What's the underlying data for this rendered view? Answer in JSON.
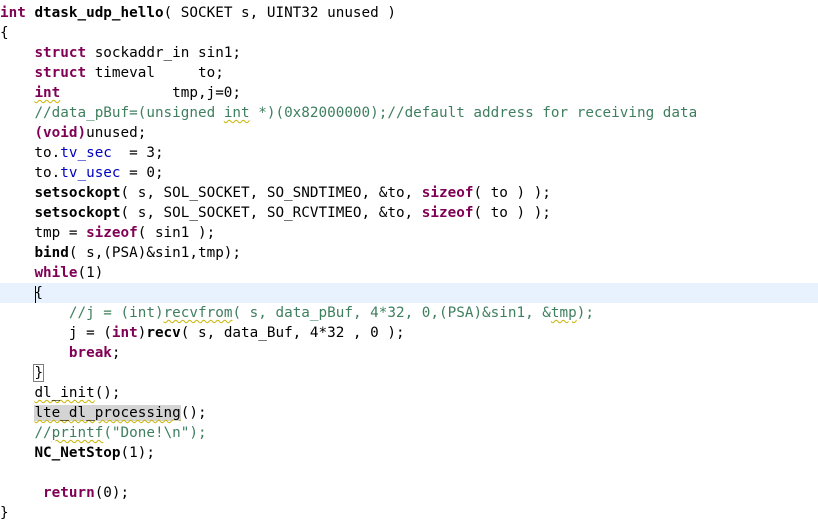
{
  "code": {
    "l1": {
      "t0": "int",
      "t1": " ",
      "t2": "dtask_udp_hello",
      "t3": "( SOCKET s, UINT32 unused )"
    },
    "l2": {
      "t0": "{"
    },
    "l3": {
      "t0": "    ",
      "t1": "struct",
      "t2": " sockaddr_in sin1;"
    },
    "l4": {
      "t0": "    ",
      "t1": "struct",
      "t2": " timeval     to;"
    },
    "l5": {
      "t0": "    ",
      "t1": "int",
      "t2": "             tmp,j=0;"
    },
    "l6": {
      "t0": "    ",
      "t1": "//data_pBuf=(unsigned ",
      "t2": "int",
      "t3": " *)(0x82000000);//default address for receiving data"
    },
    "l7": {
      "t0": "    ",
      "t1": "(void)",
      "t2": "unused;"
    },
    "l8": {
      "t0": "    to.",
      "t1": "tv_sec",
      "t2": "  = 3;"
    },
    "l9": {
      "t0": "    to.",
      "t1": "tv_usec",
      "t2": " = 0;"
    },
    "l10": {
      "t0": "    ",
      "t1": "setsockopt",
      "t2": "( s, SOL_SOCKET, SO_SNDTIMEO, &to, ",
      "t3": "sizeof",
      "t4": "( to ) );"
    },
    "l11": {
      "t0": "    ",
      "t1": "setsockopt",
      "t2": "( s, SOL_SOCKET, SO_RCVTIMEO, &to, ",
      "t3": "sizeof",
      "t4": "( to ) );"
    },
    "l12": {
      "t0": "    tmp = ",
      "t1": "sizeof",
      "t2": "( sin1 );"
    },
    "l13": {
      "t0": "    ",
      "t1": "bind",
      "t2": "( s,(PSA)&sin1,tmp);"
    },
    "l14": {
      "t0": "    ",
      "t1": "while",
      "t2": "(1)"
    },
    "l15": {
      "t0": "    {"
    },
    "l16": {
      "t0": "        ",
      "t1": "//j = (int)",
      "t2": "recvfrom",
      "t3": "( s, data_pBuf, 4*32, 0,(PSA)&sin1, &",
      "t4": "tmp",
      "t5": ");"
    },
    "l17": {
      "t0": "        j = (",
      "t1": "int",
      "t2": ")",
      "t3": "recv",
      "t4": "( s, data_Buf, 4*32 , 0 );"
    },
    "l18": {
      "t0": "        ",
      "t1": "break",
      "t2": ";"
    },
    "l19": {
      "t0": "    ",
      "t1": "}"
    },
    "l20": {
      "t0": "    ",
      "t1": "dl_init",
      "t2": "();"
    },
    "l21": {
      "t0": "    ",
      "t1": "lte_dl_processing",
      "t2": "();"
    },
    "l22": {
      "t0": "    ",
      "t1": "//",
      "t2": "printf",
      "t3": "(\"Done!\\n\");"
    },
    "l23": {
      "t0": "    ",
      "t1": "NC_NetStop",
      "t2": "(1);"
    },
    "l24": {
      "t0": ""
    },
    "l25": {
      "t0": "     ",
      "t1": "return",
      "t2": "(0);"
    },
    "l26": {
      "t0": "}"
    }
  },
  "colors": {
    "keyword": "#7f0055",
    "comment": "#3f7f5f",
    "field": "#0000c0",
    "current_line": "#e8f2fe",
    "selection": "#d4d4d4"
  }
}
